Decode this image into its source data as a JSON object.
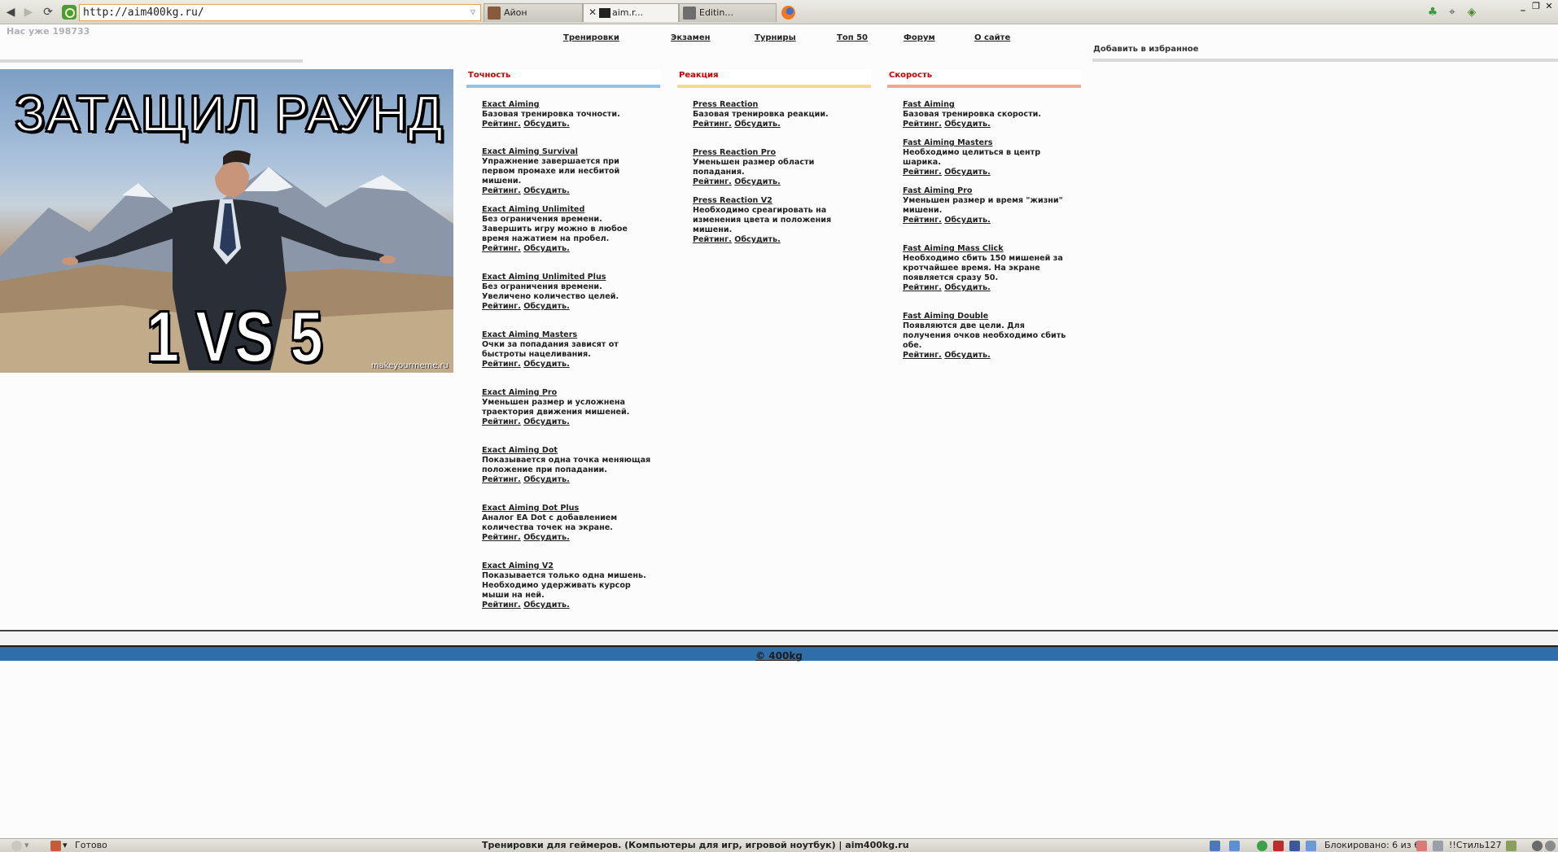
{
  "browser": {
    "url": "http://aim400kg.ru/",
    "tabs": [
      {
        "label": "Айон",
        "active": false
      },
      {
        "label": "aim.r...",
        "active": true
      },
      {
        "label": "Editin...",
        "active": false
      }
    ]
  },
  "site": {
    "counter": "Нас уже 198733",
    "nav": [
      "Тренировки",
      "Экзамен",
      "Турниры",
      "Топ 50",
      "Форум",
      "О сайте"
    ],
    "favorite": "Добавить в избранное",
    "meme": {
      "top_text": "ЗАТАЩИЛ РАУНД",
      "bottom_text": "1 VS 5",
      "watermark": "makeyourmeme.ru"
    },
    "columns": [
      {
        "title": "Точность",
        "color": "#8fc4ea",
        "items": [
          {
            "title": "Exact Aiming",
            "desc": "Базовая тренировка точности.",
            "links": [
              "Рейтинг.",
              "Обсудить."
            ]
          },
          {
            "title": "Exact Aiming Survival",
            "desc": "Упражнение завершается при первом промахе или несбитой мишени.",
            "links": [
              "Рейтинг.",
              "Обсудить."
            ]
          },
          {
            "title": "Exact Aiming Unlimited",
            "desc": "Без ограничения времени. Завершить игру можно в любое время нажатием на пробел.",
            "links": [
              "Рейтинг.",
              "Обсудить."
            ]
          },
          {
            "title": "Exact Aiming Unlimited Plus",
            "desc": "Без ограничения времени. Увеличено количество целей.",
            "links": [
              "Рейтинг.",
              "Обсудить."
            ]
          },
          {
            "title": "Exact Aiming Masters",
            "desc": "Очки за попадания зависят от быстроты нацеливания.",
            "links": [
              "Рейтинг.",
              "Обсудить."
            ]
          },
          {
            "title": "Exact Aiming Pro",
            "desc": "Уменьшен размер и усложнена траектория движения мишеней.",
            "links": [
              "Рейтинг.",
              "Обсудить."
            ]
          },
          {
            "title": "Exact Aiming Dot",
            "desc": "Показывается одна точка меняющая положение при попадании.",
            "links": [
              "Рейтинг.",
              "Обсудить."
            ]
          },
          {
            "title": "Exact Aiming Dot Plus",
            "desc": "Аналог EA Dot с добавлением количества точек на экране.",
            "links": [
              "Рейтинг.",
              "Обсудить."
            ]
          },
          {
            "title": "Exact Aiming V2",
            "desc": "Показывается только одна мишень. Необходимо удерживать курсор мыши на ней.",
            "links": [
              "Рейтинг.",
              "Обсудить."
            ]
          }
        ]
      },
      {
        "title": "Реакция",
        "color": "#f5dc8c",
        "items": [
          {
            "title": "Press Reaction",
            "desc": "Базовая тренировка реакции.",
            "links": [
              "Рейтинг.",
              "Обсудить."
            ]
          },
          {
            "title": "Press Reaction Pro",
            "desc": "Уменьшен размер области попадания.",
            "links": [
              "Рейтинг.",
              "Обсудить."
            ]
          },
          {
            "title": "Press Reaction V2",
            "desc": "Необходимо среагировать на изменения цвета и положения мишени.",
            "links": [
              "Рейтинг.",
              "Обсудить."
            ]
          }
        ]
      },
      {
        "title": "Скорость",
        "color": "#f3a98a",
        "items": [
          {
            "title": "Fast Aiming",
            "desc": "Базовая тренировка скорости.",
            "links": [
              "Рейтинг.",
              "Обсудить."
            ]
          },
          {
            "title": "Fast Aiming Masters",
            "desc": "Необходимо целиться в центр шарика.",
            "links": [
              "Рейтинг.",
              "Обсудить."
            ]
          },
          {
            "title": "Fast Aiming Pro",
            "desc": "Уменьшен размер и время \"жизни\" мишени.",
            "links": [
              "Рейтинг.",
              "Обсудить."
            ]
          },
          {
            "title": "Fast Aiming Mass Click",
            "desc": "Необходимо сбить 150 мишеней за кротчайшее время. На экране появляется сразу 50.",
            "links": [
              "Рейтинг.",
              "Обсудить."
            ]
          },
          {
            "title": "Fast Aiming Double",
            "desc": "Появляются две цели. Для получения очков необходимо сбить обе.",
            "links": [
              "Рейтинг.",
              "Обсудить."
            ]
          }
        ]
      }
    ],
    "footer": "© 400kg"
  },
  "statusbar": {
    "status": "Готово",
    "page_title": "Тренировки для геймеров. (Компьютеры для игр, игровой ноутбук) | aim400kg.ru",
    "blocked": "Блокировано: 6 из 6",
    "style": "!!Стиль127"
  }
}
